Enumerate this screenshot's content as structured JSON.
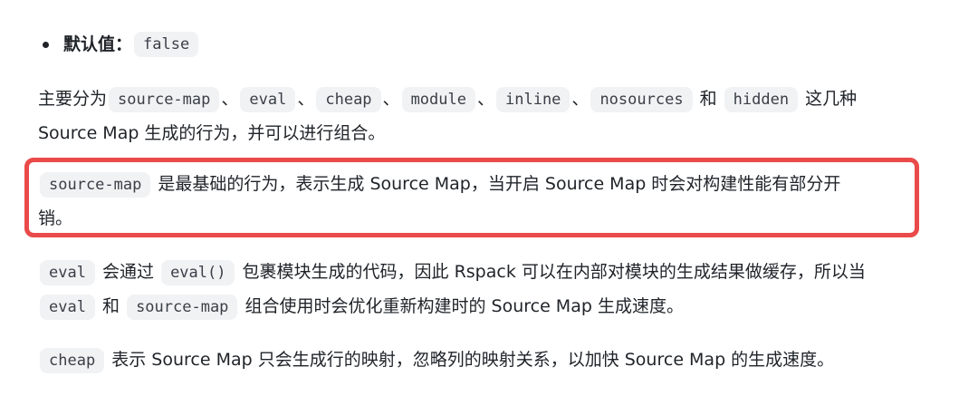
{
  "default_item": {
    "label": "默认值：",
    "value": "false"
  },
  "para1": {
    "prefix": "主要分为",
    "codes": [
      "source-map",
      "eval",
      "cheap",
      "module",
      "inline",
      "nosources",
      "hidden"
    ],
    "sep": "、",
    "and": "和",
    "suffix": "这几种",
    "line2": "Source Map 生成的行为，并可以进行组合。"
  },
  "para2": {
    "code": "source-map",
    "line1": "是最基础的行为，表示生成 Source Map，当开启 Source Map 时会对构建性能有部分开",
    "line2": "销。"
  },
  "para3": {
    "code1": "eval",
    "t1": "会通过",
    "code2": "eval()",
    "t2": "包裹模块生成的代码，因此 Rspack 可以在内部对模块的生成结果做缓存，所以当",
    "code3": "eval",
    "t3": "和",
    "code4": "source-map",
    "t4": "组合使用时会优化重新构建时的 Source Map 生成速度。"
  },
  "para4": {
    "code": "cheap",
    "text": "表示 Source Map 只会生成行的映射，忽略列的映射关系，以加快 Source Map 的生成速度。"
  },
  "colors": {
    "highlight": "#ea4a4a",
    "code_bg": "#f1f2f4"
  }
}
